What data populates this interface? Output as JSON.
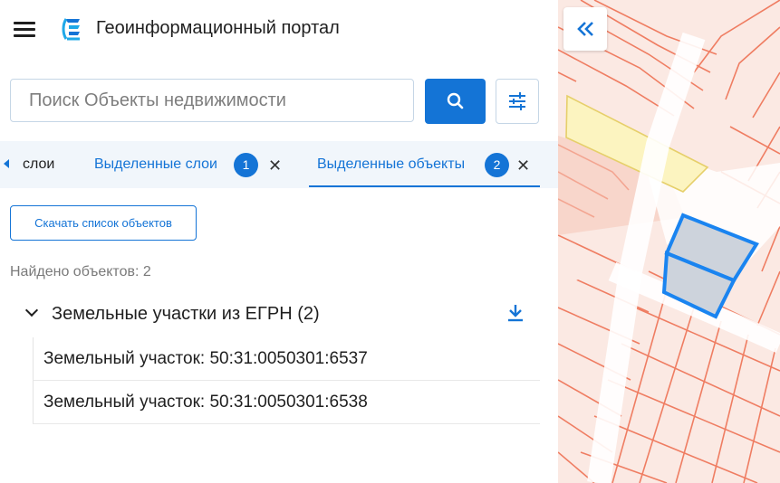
{
  "header": {
    "title": "Геоинформационный портал"
  },
  "search": {
    "placeholder": "Поиск Объекты недвижимости"
  },
  "tabs": [
    {
      "label": "слои"
    },
    {
      "label": "Выделенные слои",
      "badge": "1"
    },
    {
      "label": "Выделенные объекты",
      "badge": "2"
    }
  ],
  "actions": {
    "download_list": "Скачать список объектов"
  },
  "results": {
    "found": "Найдено объектов: 2",
    "group_title": "Земельные участки из ЕГРН (2)",
    "items": [
      "Земельный участок: 50:31:0050301:6537",
      "Земельный участок: 50:31:0050301:6538"
    ]
  },
  "icons": {
    "menu": "hamburger-menu-icon",
    "logo": "portal-logo-icon",
    "search": "search-icon",
    "filter": "filter-sliders-icon",
    "collapse": "double-chevron-left-icon",
    "download": "download-icon"
  },
  "colors": {
    "accent": "#1474d6",
    "tabs_background": "#f1f6fb",
    "map_parcel_fill": "#fbe9e3",
    "map_parcel_stroke": "#ef7d62",
    "map_highlight_fill": "#fcf4c0",
    "map_selected_fill": "#cdd3dc",
    "map_selected_stroke": "#1a84f0"
  }
}
